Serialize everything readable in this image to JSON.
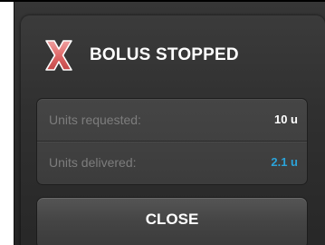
{
  "dialog": {
    "title": "BOLUS STOPPED",
    "status_icon": "stop-x-icon",
    "icon_color": "#d94a4a",
    "rows": [
      {
        "label": "Units requested:",
        "value": "10 u",
        "value_color": "#ffffff"
      },
      {
        "label": "Units delivered:",
        "value": "2.1 u",
        "value_color": "#2ba3d9"
      }
    ],
    "close_label": "CLOSE"
  }
}
